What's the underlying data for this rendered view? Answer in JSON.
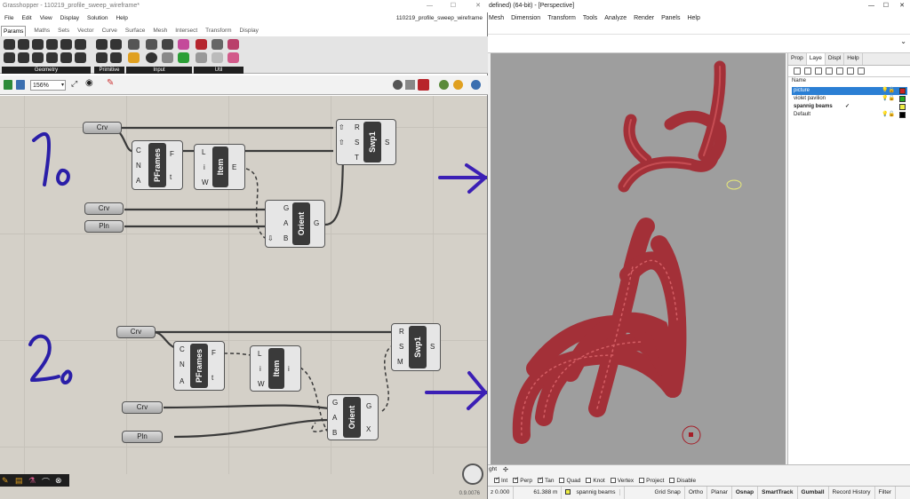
{
  "gh": {
    "title": "Grasshopper - 110219_profile_sweep_wireframe*",
    "doc_name": "110219_profile_sweep_wireframe",
    "menu": [
      "File",
      "Edit",
      "View",
      "Display",
      "Solution",
      "Help"
    ],
    "tabs": [
      "Params",
      "Maths",
      "Sets",
      "Vector",
      "Curve",
      "Surface",
      "Mesh",
      "Intersect",
      "Transform",
      "Display"
    ],
    "ribbon_groups": [
      "Geometry",
      "Primitive",
      "Input",
      "Util"
    ],
    "zoom": "156%",
    "version": "0.9.0076",
    "annotations": [
      "1a",
      "2a"
    ],
    "group1": {
      "crv_top": "Crv",
      "pframes": {
        "label": "PFrames",
        "inputs": [
          "C",
          "N",
          "A"
        ],
        "outputs": [
          "F",
          "t"
        ]
      },
      "item": {
        "label": "Item",
        "inputs": [
          "L",
          "i",
          "W"
        ],
        "outputs": [
          "E"
        ]
      },
      "swp1": {
        "label": "Swp1",
        "inputs": [
          "R",
          "S",
          "T"
        ],
        "outputs": [
          "S"
        ]
      },
      "crv": "Crv",
      "pln": "Pln",
      "orient": {
        "label": "Orient",
        "inputs": [
          "G",
          "A",
          "B"
        ],
        "outputs": [
          "G"
        ]
      }
    },
    "group2": {
      "crv_top": "Crv",
      "pframes": {
        "label": "PFrames",
        "inputs": [
          "C",
          "N",
          "A"
        ],
        "outputs": [
          "F",
          "t"
        ]
      },
      "item": {
        "label": "Item",
        "inputs": [
          "L",
          "i",
          "W"
        ],
        "outputs": [
          "i"
        ]
      },
      "swp1": {
        "label": "Swp1",
        "inputs": [
          "R",
          "S",
          "M"
        ],
        "outputs": [
          "S"
        ]
      },
      "crv": "Crv",
      "pln": "Pln",
      "orient": {
        "label": "Orient",
        "inputs": [
          "G",
          "A",
          "B"
        ],
        "outputs": [
          "G",
          "X"
        ]
      }
    }
  },
  "rhino": {
    "title": "defined) (64-bit) - [Perspective]",
    "menu": [
      "Mesh",
      "Dimension",
      "Transform",
      "Tools",
      "Analyze",
      "Render",
      "Panels",
      "Help"
    ],
    "panel_tabs": [
      "Prop",
      "Laye",
      "Displ",
      "Help"
    ],
    "layer_header": "Name",
    "layers": [
      {
        "name": "picture",
        "color": "#cc2222",
        "selected": true
      },
      {
        "name": "violet pavilion",
        "color": "#22aa22",
        "selected": false
      },
      {
        "name": "spannig beams",
        "color": "#eeee44",
        "selected": false,
        "current": true
      },
      {
        "name": "Default",
        "color": "#000000",
        "selected": false
      }
    ],
    "osnaps": [
      {
        "label": "Int",
        "on": true
      },
      {
        "label": "Perp",
        "on": true
      },
      {
        "label": "Tan",
        "on": true
      },
      {
        "label": "Quad",
        "on": false
      },
      {
        "label": "Knot",
        "on": false
      },
      {
        "label": "Vertex",
        "on": false
      },
      {
        "label": "Project",
        "on": false
      },
      {
        "label": "Disable",
        "on": false
      }
    ],
    "status": {
      "coord": "z 0.000",
      "units": "61.388 m",
      "layer": "spannig beams",
      "toggles": [
        "Grid Snap",
        "Ortho",
        "Planar",
        "Osnap",
        "SmartTrack",
        "Gumball",
        "Record History",
        "Filter"
      ],
      "bold_toggles": [
        "Osnap",
        "SmartTrack",
        "Gumball"
      ]
    },
    "viewport_tab": "ght"
  },
  "colors": {
    "tube": "#b3202a",
    "arrow": "#3b1fb5",
    "layer_sel": "#2b7fd4"
  }
}
